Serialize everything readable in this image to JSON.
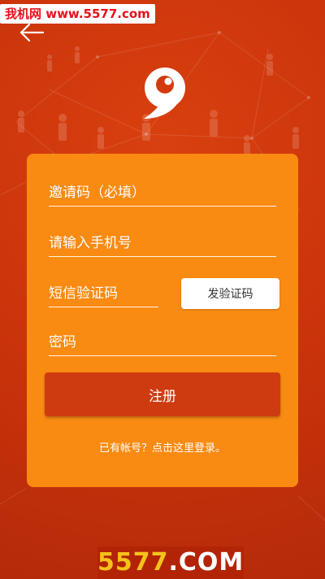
{
  "watermark_top": "我机网 www.5577.com",
  "watermark_bottom": {
    "prefix": "5577",
    "suffix": ".COM"
  },
  "icons": {
    "back": "arrow-left-icon",
    "logo": "app-logo-icon"
  },
  "colors": {
    "background": "#c9330b",
    "card": "#f98a12",
    "primary_button": "#cf3b10"
  },
  "form": {
    "invite_code": {
      "value": "",
      "placeholder": "邀请码（必填）"
    },
    "phone": {
      "value": "",
      "placeholder": "请输入手机号"
    },
    "sms_code": {
      "value": "",
      "placeholder": "短信验证码"
    },
    "password": {
      "value": "",
      "placeholder": "密码"
    },
    "send_code_label": "发验证码",
    "register_label": "注册",
    "login_link": "已有帐号？点击这里登录。"
  }
}
